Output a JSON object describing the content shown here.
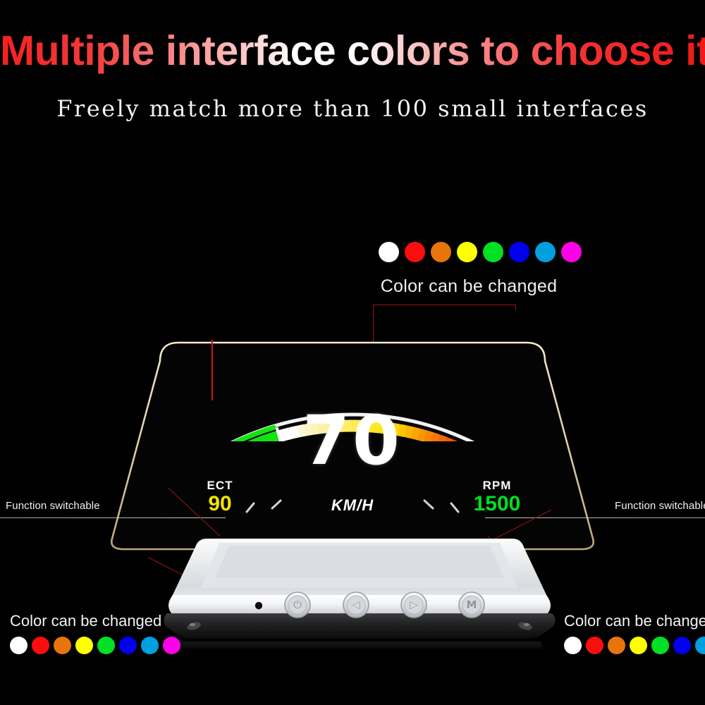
{
  "headline": "Multiple interface colors to choose it",
  "subheadline": "Freely match more than 100 small interfaces",
  "palette": {
    "caption": "Color can be changed",
    "colors": [
      "#ffffff",
      "#fb0d0d",
      "#e8740c",
      "#ffff00",
      "#00e024",
      "#0000ee",
      "#00a0e0",
      "#ff00e8"
    ],
    "color_names": [
      "white",
      "red",
      "orange",
      "yellow",
      "green",
      "blue",
      "cyan",
      "magenta"
    ]
  },
  "hud": {
    "speed": "70",
    "unit": "KM/H",
    "ect": {
      "label": "ECT",
      "value": "90",
      "color": "#f2e400"
    },
    "rpm": {
      "label": "RPM",
      "value": "1500",
      "color": "#00e01c"
    },
    "gauge": {
      "green_segments": 8,
      "marker_segments": 3,
      "ramp_segments": 27,
      "green_color": "#13e313",
      "ramp_start_color": "#fbf6d8",
      "ramp_mid_color": "#ffe400",
      "ramp_end_color": "#f01a10",
      "pointer_color": "#d31414"
    }
  },
  "device": {
    "buttons": [
      {
        "name": "power-button",
        "glyph": "⏻"
      },
      {
        "name": "left-button",
        "glyph": "◁"
      },
      {
        "name": "right-button",
        "glyph": "▷"
      },
      {
        "name": "menu-button",
        "glyph": "M"
      }
    ],
    "sensor_label": "sensor"
  },
  "callouts": {
    "function_switchable": "Function switchable",
    "color_can_be_changed": "Color can be changed"
  }
}
